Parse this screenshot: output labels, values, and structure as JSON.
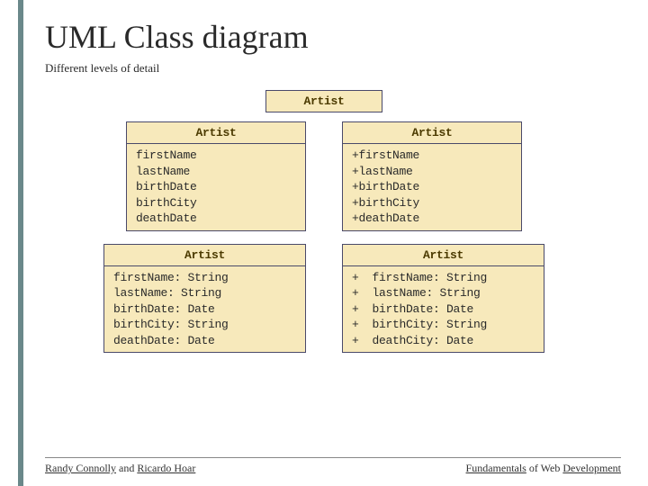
{
  "title": "UML Class diagram",
  "subtitle": "Different levels of detail",
  "box_top": {
    "name": "Artist"
  },
  "box_left1": {
    "name": "Artist",
    "attrs": [
      "firstName",
      "lastName",
      "birthDate",
      "birthCity",
      "deathDate"
    ]
  },
  "box_right1": {
    "name": "Artist",
    "attrs": [
      "+firstName",
      "+lastName",
      "+birthDate",
      "+birthCity",
      "+deathDate"
    ]
  },
  "box_left2": {
    "name": "Artist",
    "attrs": [
      "firstName: String",
      "lastName: String",
      "birthDate: Date",
      "birthCity: String",
      "deathDate: Date"
    ]
  },
  "box_right2": {
    "name": "Artist",
    "attrs": [
      "+  firstName: String",
      "+  lastName: String",
      "+  birthDate: Date",
      "+  birthCity: String",
      "+  deathCity: Date"
    ]
  },
  "footer": {
    "left_author1": "Randy Connolly",
    "left_mid": " and ",
    "left_author2": "Ricardo Hoar",
    "right_w1": "Fundamentals",
    "right_m": " of Web ",
    "right_w2": "Development"
  }
}
